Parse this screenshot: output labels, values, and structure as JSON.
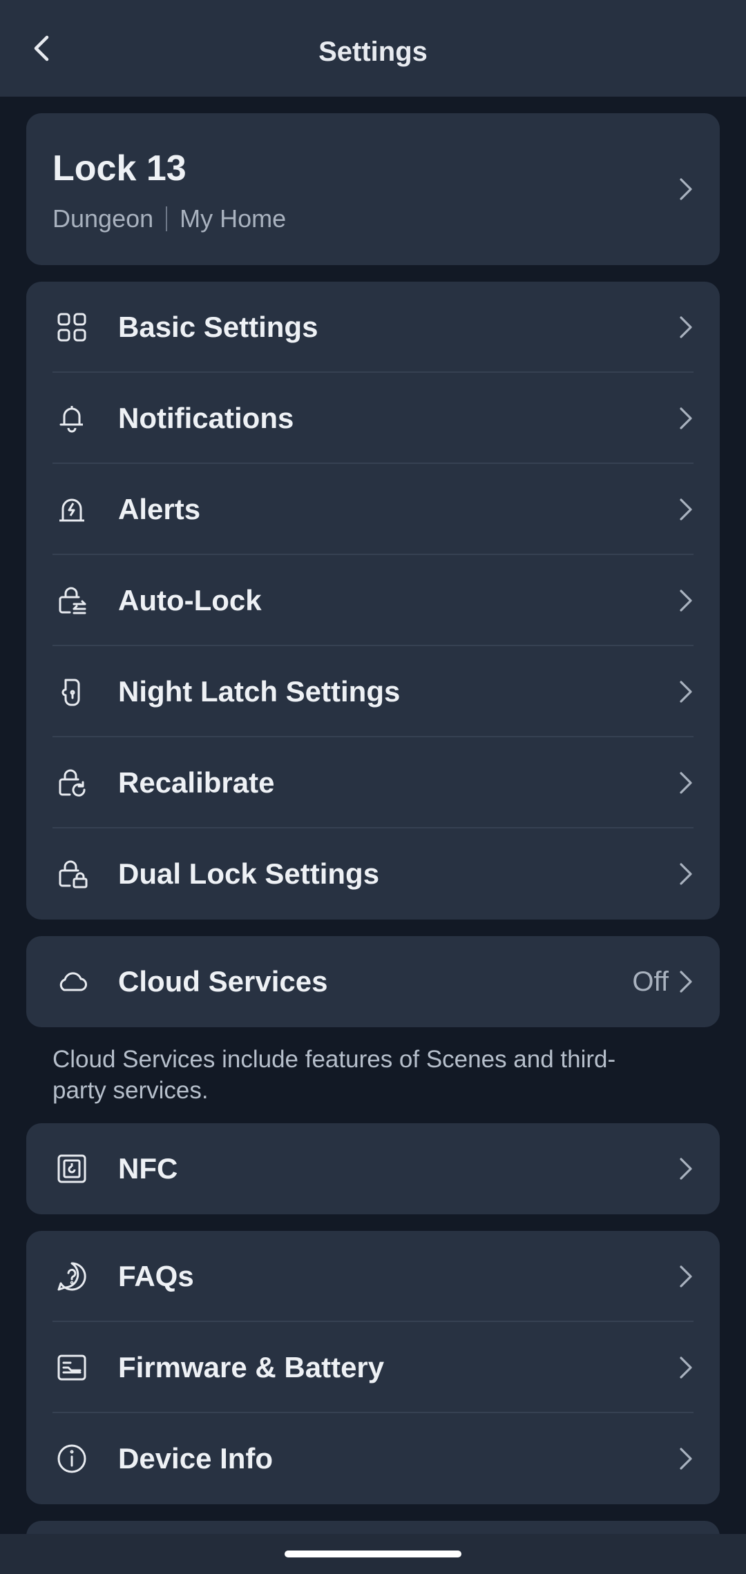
{
  "header": {
    "title": "Settings"
  },
  "device": {
    "name": "Lock 13",
    "room": "Dungeon",
    "home": "My Home"
  },
  "settings_items": [
    {
      "label": "Basic Settings",
      "icon": "grid-icon"
    },
    {
      "label": "Notifications",
      "icon": "bell-icon"
    },
    {
      "label": "Alerts",
      "icon": "alarm-icon"
    },
    {
      "label": "Auto-Lock",
      "icon": "auto-lock-icon"
    },
    {
      "label": "Night Latch Settings",
      "icon": "night-latch-icon"
    },
    {
      "label": "Recalibrate",
      "icon": "recalibrate-icon"
    },
    {
      "label": "Dual Lock Settings",
      "icon": "dual-lock-icon"
    }
  ],
  "cloud": {
    "label": "Cloud Services",
    "value": "Off",
    "description": "Cloud Services include features of Scenes and third-party services."
  },
  "nfc": {
    "label": "NFC"
  },
  "help_items": [
    {
      "label": "FAQs",
      "icon": "question-icon"
    },
    {
      "label": "Firmware & Battery",
      "icon": "firmware-icon"
    },
    {
      "label": "Device Info",
      "icon": "info-icon"
    }
  ],
  "colors": {
    "background": "#121925",
    "card": "#283242",
    "header": "#273141",
    "text": "#eef1f5",
    "secondary_text": "#a9b2bf"
  }
}
